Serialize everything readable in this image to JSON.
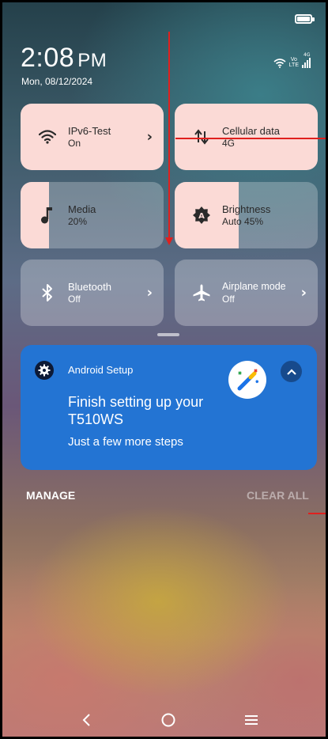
{
  "status": {
    "time": "2:08",
    "ampm": "PM",
    "date": "Mon, 08/12/2024",
    "volte": [
      "Vo",
      "LTE"
    ],
    "network_tag": "4G",
    "icons": [
      "battery-icon",
      "wifi-icon",
      "volte-icon",
      "signal-icon"
    ]
  },
  "tiles": {
    "wifi": {
      "label": "IPv6-Test",
      "status": "On",
      "icon": "wifi-icon"
    },
    "cellular": {
      "label": "Cellular data",
      "status": "4G",
      "icon": "data-arrows-icon"
    },
    "media": {
      "label": "Media",
      "status": "20%",
      "level": 0.2,
      "icon": "music-note-icon"
    },
    "brightness": {
      "label": "Brightness",
      "status": "Auto 45%",
      "level": 0.45,
      "icon": "brightness-auto-icon"
    },
    "bluetooth": {
      "label": "Bluetooth",
      "status": "Off",
      "icon": "bluetooth-icon"
    },
    "airplane": {
      "label": "Airplane mode",
      "status": "Off",
      "icon": "airplane-icon"
    }
  },
  "notification": {
    "app": "Android Setup",
    "title": "Finish setting up your T510WS",
    "body": "Just a few more steps",
    "icons": [
      "gear-icon",
      "magic-wand-icon",
      "chevron-up-icon"
    ]
  },
  "actions": {
    "manage": "MANAGE",
    "clear_all": "CLEAR ALL"
  },
  "nav": [
    "back-icon",
    "home-icon",
    "menu-icon"
  ],
  "colors": {
    "tile_active": "#fbdad6",
    "notification_bg": "#2374d3",
    "annotation": "#e0201e"
  }
}
